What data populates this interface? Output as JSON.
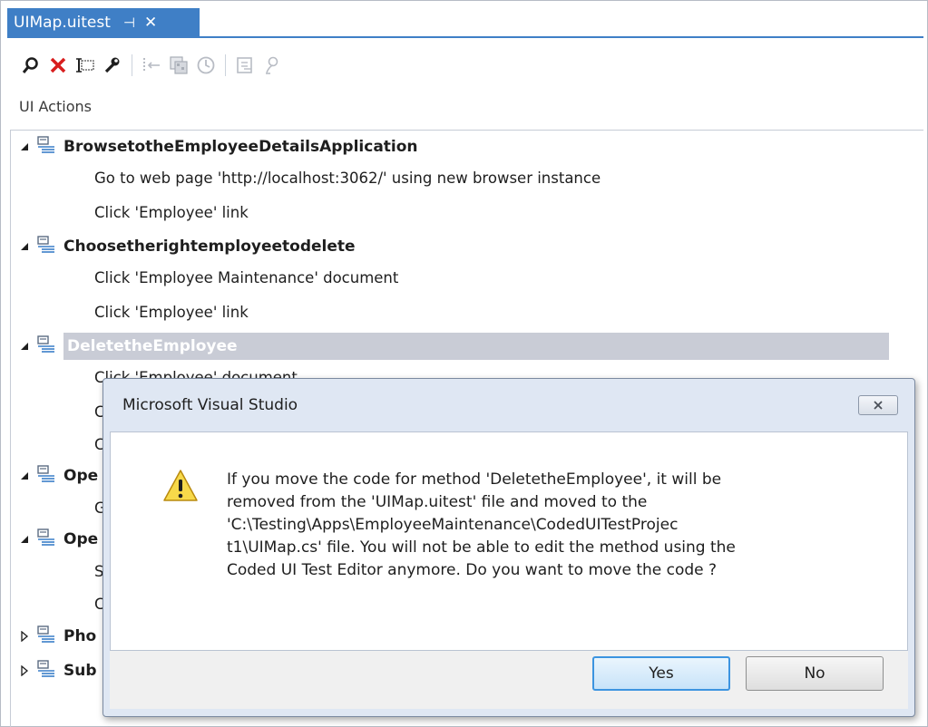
{
  "tab": {
    "title": "UIMap.uitest",
    "pin_glyph": "⊣",
    "close_glyph": "✕"
  },
  "toolbar": {
    "icons": [
      "find-icon",
      "delete-icon",
      "rename-icon",
      "properties-icon",
      "split-icon",
      "insert-step-icon",
      "delay-icon",
      "move-code-icon",
      "locate-icon"
    ]
  },
  "section_label": "UI Actions",
  "tree": {
    "methods": [
      {
        "name": "BrowsetotheEmployeeDetailsApplication",
        "expanded": true,
        "actions": [
          "Go to web page 'http://localhost:3062/' using new browser instance",
          "Click 'Employee' link"
        ]
      },
      {
        "name": "Choosetherightemployeetodelete",
        "expanded": true,
        "actions": [
          "Click 'Employee Maintenance' document",
          "Click 'Employee' link"
        ]
      },
      {
        "name": "DeletetheEmployee",
        "expanded": true,
        "selected": true,
        "actions": [
          "Click 'Employee' document",
          "C",
          "C"
        ]
      },
      {
        "name": "Ope",
        "expanded": true,
        "actions": [
          "G"
        ]
      },
      {
        "name": "Ope",
        "expanded": true,
        "actions": [
          "S",
          "C"
        ]
      },
      {
        "name": "Pho",
        "expanded": false,
        "actions": []
      },
      {
        "name": "Sub",
        "expanded": false,
        "actions": []
      }
    ]
  },
  "dialog": {
    "title": "Microsoft Visual Studio",
    "message": "If you move the code for method 'DeletetheEmployee', it will be\nremoved from the 'UIMap.uitest' file and moved to the\n'C:\\Testing\\Apps\\EmployeeMaintenance\\CodedUITestProjec\nt1\\UIMap.cs' file. You will not be able to edit the method using the\nCoded UI Test Editor anymore. Do you want to move the code ?",
    "yes_label": "Yes",
    "no_label": "No"
  },
  "colors": {
    "accent": "#3f7fc6",
    "selection": "#c9ccd6",
    "dialog_frame": "#dfe7f3"
  }
}
